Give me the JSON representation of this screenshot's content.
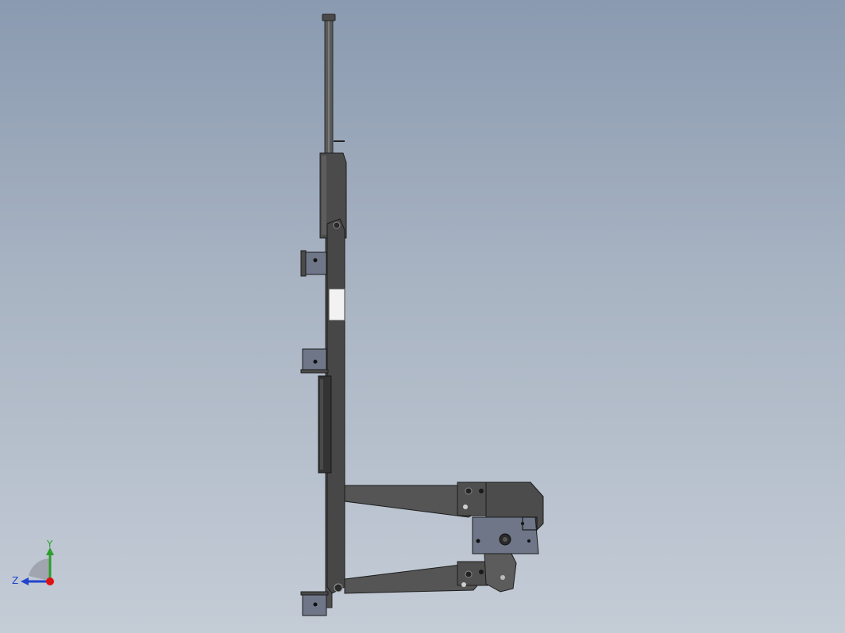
{
  "viewport": {
    "background_top": "#8a9ab0",
    "background_bottom": "#c4ccd6"
  },
  "triad": {
    "y_label": "Y",
    "z_label": "Z",
    "y_color": "#2e9e2e",
    "z_color": "#2244cc",
    "x_color": "#dd1111"
  },
  "model": {
    "part_color_dark": "#3d3d3d",
    "part_color_mid": "#5c5c5c",
    "bracket_color": "#6e7688",
    "insulator_color": "#f2f2f2"
  }
}
